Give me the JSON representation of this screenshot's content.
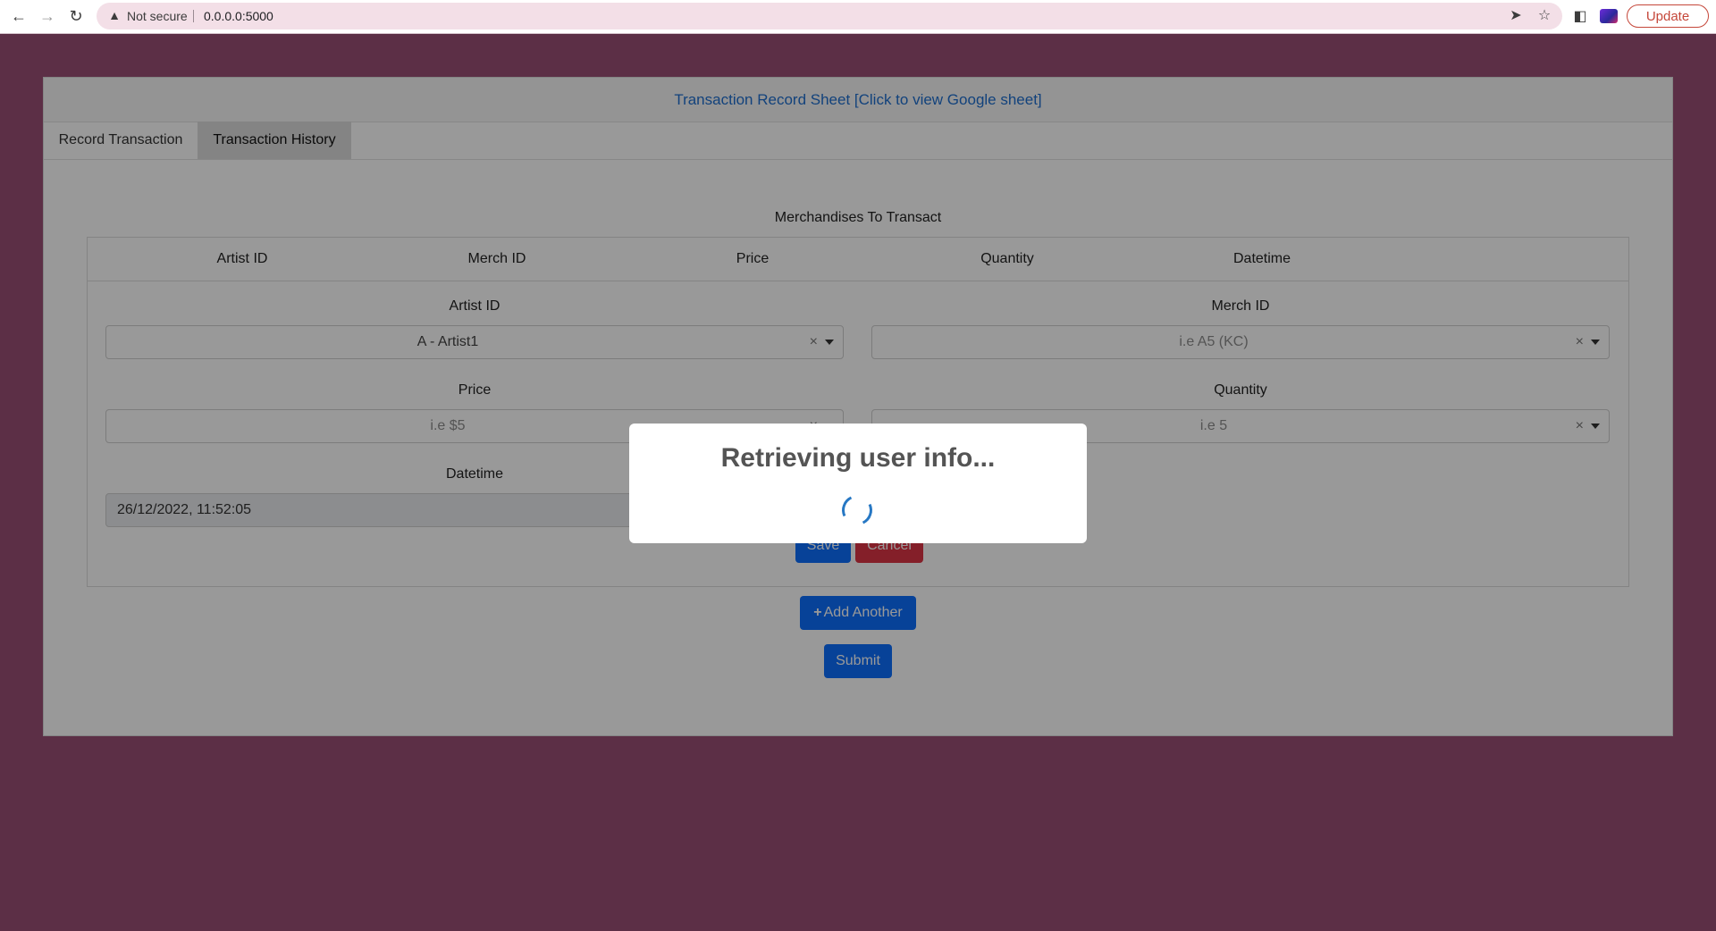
{
  "browser": {
    "security_label": "Not secure",
    "url": "0.0.0.0:5000",
    "update_label": "Update"
  },
  "header": {
    "link_text": "Transaction Record Sheet [Click to view Google sheet]"
  },
  "tabs": [
    {
      "label": "Record Transaction",
      "active": false
    },
    {
      "label": "Transaction History",
      "active": true
    }
  ],
  "section_title": "Merchandises To Transact",
  "table": {
    "columns": [
      "Artist ID",
      "Merch ID",
      "Price",
      "Quantity",
      "Datetime"
    ]
  },
  "form": {
    "artist": {
      "label": "Artist ID",
      "value": "A - Artist1"
    },
    "merch": {
      "label": "Merch ID",
      "placeholder": "i.e A5 (KC)"
    },
    "price": {
      "label": "Price",
      "placeholder": "i.e $5"
    },
    "quantity": {
      "label": "Quantity",
      "placeholder": "i.e 5"
    },
    "datetime": {
      "label": "Datetime",
      "value": "26/12/2022, 11:52:05"
    },
    "save_label": "Save",
    "cancel_label": "Cancel",
    "add_another_label": "Add Another",
    "submit_label": "Submit"
  },
  "modal": {
    "title": "Retrieving user info..."
  },
  "colors": {
    "page_background": "#9a4f75",
    "primary": "#0d6efd",
    "danger": "#dc3545",
    "link": "#1f6fcf"
  }
}
